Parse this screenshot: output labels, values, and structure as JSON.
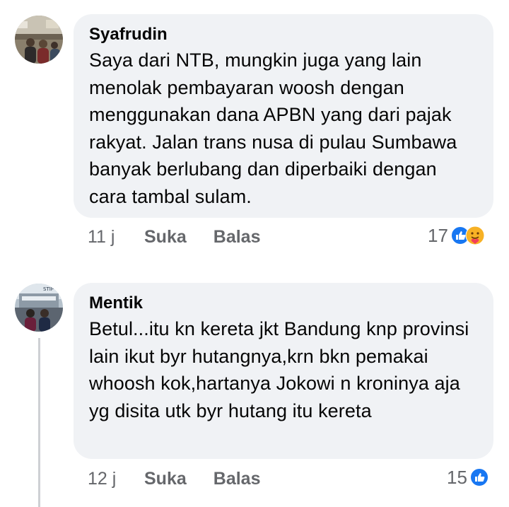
{
  "comments": [
    {
      "author": "Syafrudin",
      "text": "Saya dari NTB, mungkin juga yang lain menolak pembayaran woosh dengan menggunakan dana APBN yang dari pajak rakyat. Jalan trans nusa di pulau Sumbawa banyak berlubang dan diperbaiki dengan cara tambal sulam.",
      "time": "11 j",
      "like_label": "Suka",
      "reply_label": "Balas",
      "reaction_count": "17",
      "reactions": [
        "like-icon",
        "care-icon"
      ]
    },
    {
      "author": "Mentik",
      "text": "Betul...itu kn kereta jkt Bandung knp provinsi lain ikut byr hutangnya,krn bkn pemakai whoosh kok,hartanya Jokowi n kroninya aja yg disita utk byr hutang itu kereta",
      "time": "12 j",
      "like_label": "Suka",
      "reply_label": "Balas",
      "reaction_count": "15",
      "reactions": [
        "like-icon"
      ]
    }
  ],
  "colors": {
    "bubble": "#f0f2f5",
    "meta_text": "#65676b",
    "like_blue": "#1877f2",
    "care_yellow": "#f7b125"
  }
}
